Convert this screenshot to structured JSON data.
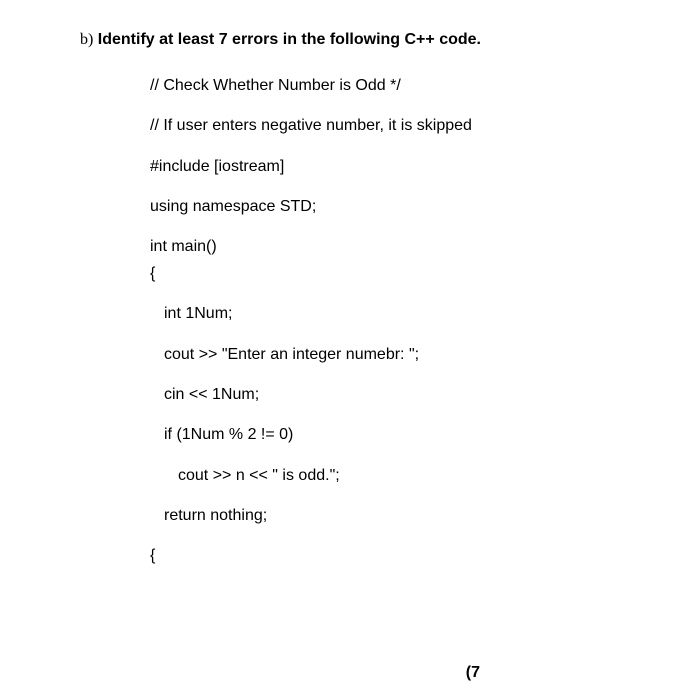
{
  "question": {
    "label": "b)",
    "title": "Identify at least 7 errors in the following C++ code."
  },
  "code": {
    "l1": "// Check Whether Number is Odd */",
    "l2": "// If user enters negative number, it is skipped",
    "l3": "#include [iostream]",
    "l4": "using namespace STD;",
    "l5": "int main()",
    "l6": "{",
    "l7": "int 1Num;",
    "l8": "cout >> \"Enter an integer numebr: \";",
    "l9": "cin << 1Num;",
    "l10": "if (1Num % 2 != 0)",
    "l11": "cout >> n << \" is odd.\";",
    "l12": "return nothing;",
    "l13": "{"
  },
  "points": "(7"
}
